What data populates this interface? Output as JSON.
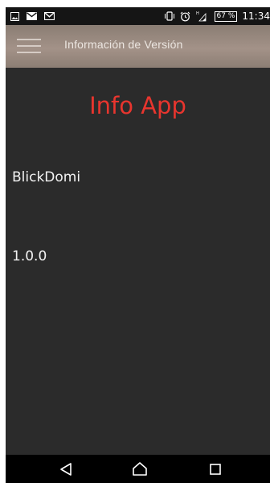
{
  "status_bar": {
    "battery": "67 %",
    "clock": "11:34",
    "icons": [
      "image-icon",
      "mail-icon",
      "gmail-icon",
      "vibrate-icon",
      "alarm-icon",
      "signal-icon",
      "battery-icon"
    ]
  },
  "app_bar": {
    "title": "Información de Versión",
    "menu_icon": "hamburger-menu-icon"
  },
  "content": {
    "heading": "Info App",
    "app_name": "BlickDomi",
    "version": "1.0.0"
  },
  "nav_bar": {
    "icons": [
      "back-icon",
      "home-icon",
      "recent-apps-icon"
    ]
  },
  "colors": {
    "heading": "#e8352e",
    "background": "#2b2b2b",
    "app_bar": "#a39288",
    "status_bar": "#151515",
    "nav_bar": "#000000"
  }
}
